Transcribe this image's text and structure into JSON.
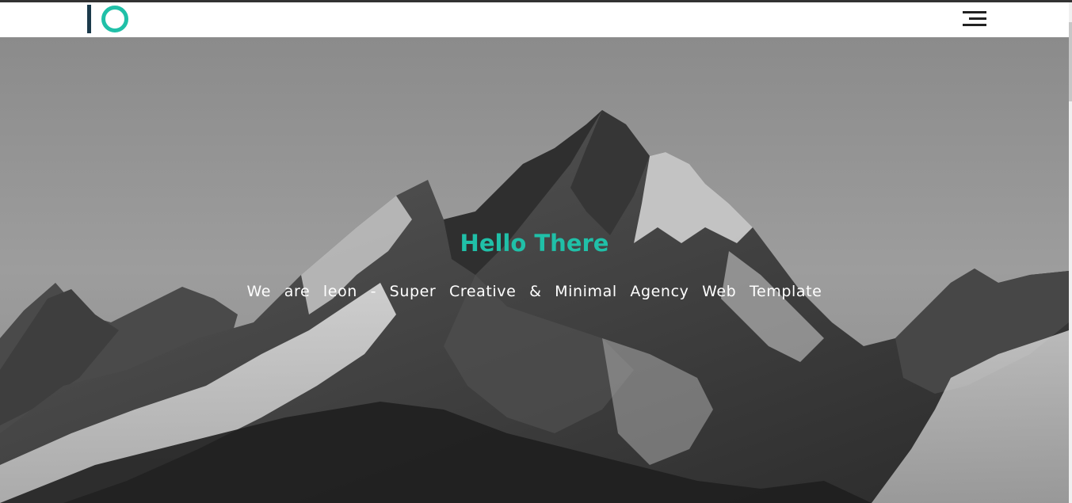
{
  "header": {
    "logo": {
      "text": "lO",
      "icon": "leon-logo",
      "accent": "#20c0a8",
      "dark": "#1b3a4b"
    },
    "menu": {
      "icon": "hamburger-menu-icon"
    }
  },
  "hero": {
    "title": "Hello There",
    "subtitle": "We are leon - Super Creative & Minimal Agency Web Template",
    "title_color": "#20c0a8",
    "background": "black-and-white snowy mountain peak"
  },
  "colors": {
    "accent": "#20c0a8",
    "nav_bg": "#ffffff",
    "text_on_hero": "#ffffff"
  }
}
